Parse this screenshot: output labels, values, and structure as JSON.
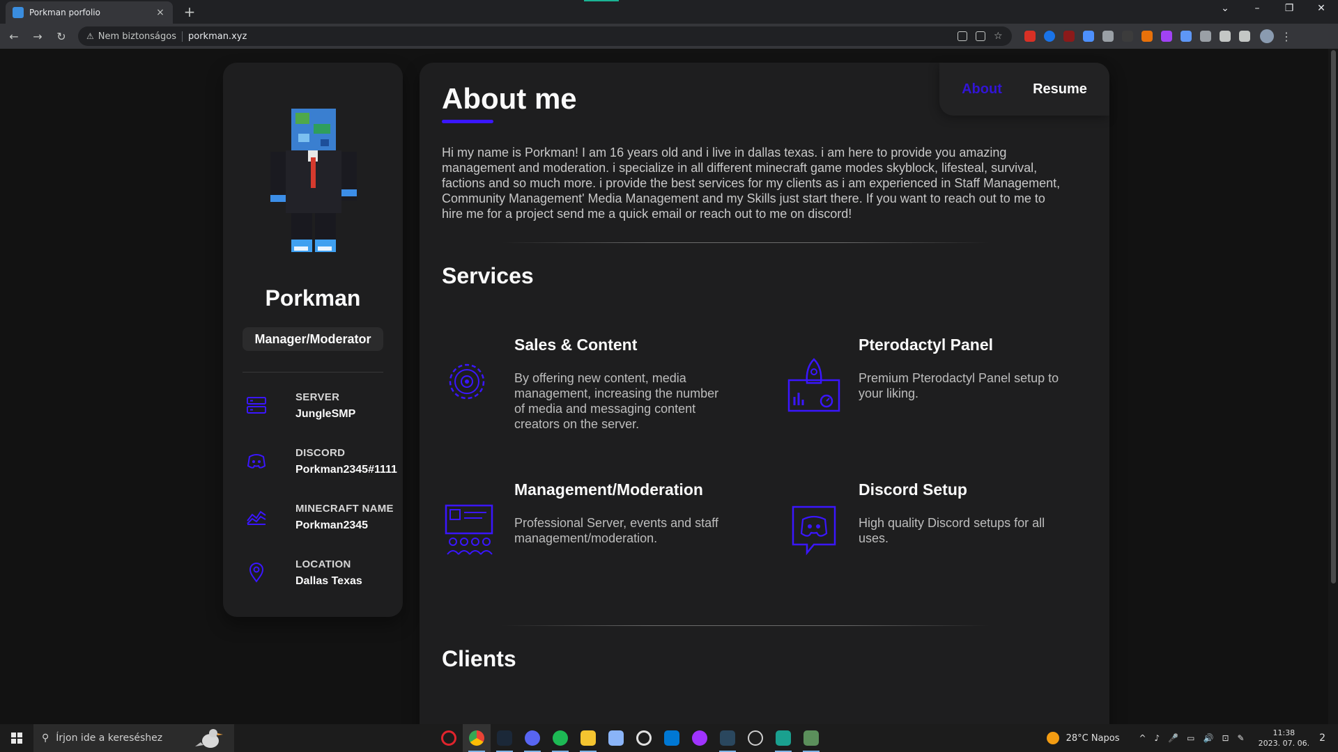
{
  "browser": {
    "tab_title": "Porkman porfolio",
    "tab_close": "×",
    "new_tab": "+",
    "insecure_label": "Nem biztonságos",
    "url": "porkman.xyz",
    "nav": {
      "back": "←",
      "forward": "→",
      "reload": "↻"
    },
    "window_controls": {
      "list": "⌄",
      "minimize": "–",
      "restore": "❐",
      "close": "✕"
    }
  },
  "profile": {
    "name": "Porkman",
    "role": "Manager/Moderator",
    "contacts": [
      {
        "label": "SERVER",
        "value": "JungleSMP",
        "icon": "server-icon"
      },
      {
        "label": "DISCORD",
        "value": "Porkman2345#1111",
        "icon": "discord-icon"
      },
      {
        "label": "MINECRAFT NAME",
        "value": "Porkman2345",
        "icon": "chart-icon"
      },
      {
        "label": "LOCATION",
        "value": "Dallas Texas",
        "icon": "location-pin-icon"
      }
    ]
  },
  "nav": {
    "about": "About",
    "resume": "Resume"
  },
  "about": {
    "title": "About me",
    "text": "Hi my name is Porkman! I am 16 years old and i live in dallas texas. i am here to provide you amazing management and moderation. i specialize in all different minecraft game modes skyblock, lifesteal, survival, factions and so much more. i provide the best services for my clients as i am experienced in Staff Management, Community Management' Media Management and my Skills just start there. If you want to reach out to me to hire me for a project send me a quick email or reach out to me on discord!"
  },
  "services": {
    "title": "Services",
    "items": [
      {
        "title": "Sales & Content",
        "desc": "By offering new content, media management, increasing the number of media and messaging content creators on the server.",
        "icon": "gear-icon"
      },
      {
        "title": "Pterodactyl Panel",
        "desc": "Premium Pterodactyl Panel setup to your liking.",
        "icon": "rocket-icon"
      },
      {
        "title": "Management/Moderation",
        "desc": "Professional Server, events and staff management/moderation.",
        "icon": "team-board-icon"
      },
      {
        "title": "Discord Setup",
        "desc": "High quality Discord setups for all uses.",
        "icon": "discord-chat-icon"
      }
    ]
  },
  "clients": {
    "title": "Clients"
  },
  "colors": {
    "accent": "#3a16ff",
    "background": "#121212",
    "card": "#1e1e1f"
  },
  "taskbar": {
    "search_placeholder": "Írjon ide a kereséshez",
    "search_icon": "⚲",
    "weather": "28°C  Napos",
    "time": "11:38",
    "date": "2023. 07. 06.",
    "notification_count": "2",
    "tray_glyphs": [
      "^",
      "♪",
      "🎤",
      "▭",
      "🔊",
      "⊡",
      "✎"
    ]
  }
}
